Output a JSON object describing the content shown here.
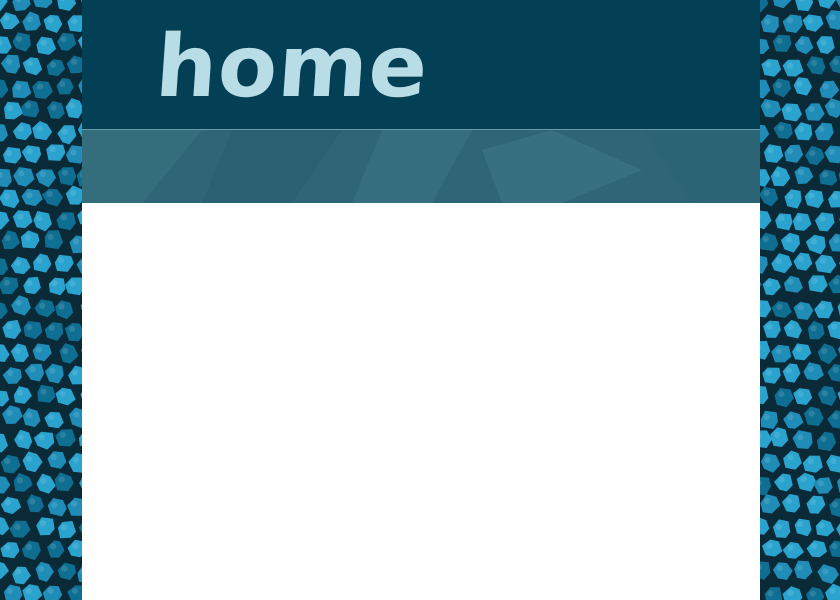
{
  "header": {
    "title": "home"
  },
  "colors": {
    "header_bg": "#033f55",
    "title_text": "#b8dde6",
    "band_bg": "#2e6677",
    "content_bg": "#ffffff",
    "tile_light": "#2aa3cf",
    "tile_dark": "#0f6f93",
    "grout": "#0a2a38"
  },
  "decorations": {
    "side_pattern": "blue-mosaic-tiles"
  }
}
